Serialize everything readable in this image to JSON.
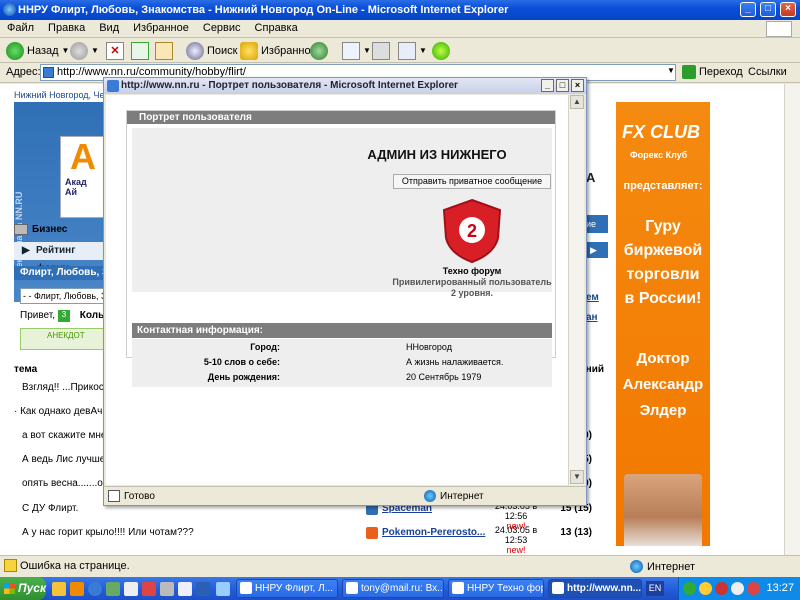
{
  "window": {
    "title": "ННРУ Флирт, Любовь, Знакомства - Нижний Новгород On-Line - Microsoft Internet Explorer",
    "caption_min": "_",
    "caption_max": "□",
    "caption_close": "×"
  },
  "menu": [
    "Файл",
    "Правка",
    "Вид",
    "Избранное",
    "Сервис",
    "Справка"
  ],
  "toolbar": {
    "back_label": "Назад",
    "search_label": "Поиск",
    "favorites_label": "Избранное"
  },
  "address": {
    "label": "Адрес:",
    "value": "http://www.nn.ru/community/hobby/flirt/",
    "go_label": "Переход",
    "links_label": "Ссылки"
  },
  "page": {
    "site_link": "Нижний Новгород, Чет",
    "banner_side": "реклама на NN.RU",
    "banner_brand": "Акад",
    "banner_brand2": "Ай",
    "tab_business": "Бизнес",
    "rating_label": "Рейтинг форум",
    "section_bar": "Флирт, Любовь, З",
    "section_select": "- - Флирт, Любовь, З",
    "greeting": "Привет,",
    "greeting_link": "Кольц",
    "anekdot_label": "АНЕКДОТ",
    "right_big": "А",
    "right_tab": "ие",
    "right_tab2": "",
    "right_links": [
      "ем",
      "ан"
    ],
    "topics_header": "тема",
    "topics_header_right": "ний",
    "topics": [
      {
        "title": "Взгляд!! ...Прикос",
        "author": "",
        "date": "",
        "new": "",
        "count": ""
      },
      {
        "title": "· Как однако девАч",
        "author": "",
        "date": "",
        "new": "",
        "count": ""
      },
      {
        "title": "а вот скажите мне",
        "author": "",
        "date": "",
        "new": "",
        "count": "0)"
      },
      {
        "title": "А ведь Лис лучше в",
        "author": "",
        "date": "",
        "new": "",
        "count": "5)"
      },
      {
        "title": "опять весна.......оп",
        "author": "",
        "date": "",
        "new": "",
        "count": "0)"
      },
      {
        "title": "С ДУ Флирт.",
        "author": "Spaceman",
        "date": "24.03.05 в 12:56",
        "new": "new!",
        "count": "15 (15)"
      },
      {
        "title": "А у нас горит крыло!!!! Или чотам???",
        "author": "Pokemon-Pererosto...",
        "date": "24.03.05 в 12:53",
        "new": "new!",
        "count": "13 (13)"
      }
    ]
  },
  "fx_banner": {
    "logo": "FX CLUB",
    "sub": "Форекс Клуб",
    "presents": "представляет:",
    "lines": [
      "Гуру",
      "биржевой",
      "торговли",
      "в России!"
    ],
    "doctor": [
      "Доктор",
      "Александр",
      "Элдер"
    ]
  },
  "status": {
    "text": "Ошибка на странице.",
    "zone": "Интернет"
  },
  "popup": {
    "title": "http://www.nn.ru - Портрет пользователя - Microsoft Internet Explorer",
    "section_title": "Портрет пользователя",
    "user_name": "АДМИН ИЗ НИЖНЕГО",
    "pm_button": "Отправить приватное сообщение",
    "rank_number": "2",
    "rank_forum": "Техно форум",
    "rank_desc_1": "Привилегированный пользователь",
    "rank_desc_2": "2 уровня.",
    "contact_title": "Контактная информация:",
    "contacts": [
      {
        "label": "Город:",
        "value": "ННовгород"
      },
      {
        "label": "5-10 слов о себе:",
        "value": "А жизнь налаживается."
      },
      {
        "label": "День рождения:",
        "value": "20 Сентябрь 1979"
      }
    ],
    "status_text": "Готово",
    "status_zone": "Интернет"
  },
  "taskbar": {
    "start": "Пуск",
    "tasks": [
      {
        "label": "ННРУ Флирт, Л...",
        "active": false
      },
      {
        "label": "tony@mail.ru: Вх...",
        "active": false
      },
      {
        "label": "ННРУ Техно фор...",
        "active": false
      },
      {
        "label": "http://www.nn....",
        "active": true
      }
    ],
    "lang": "EN",
    "clock": "13:27"
  },
  "colors": {
    "accent_blue": "#2f6fb5",
    "fx_orange": "#f27800",
    "rank_red": "#d91f26",
    "new_red": "#dd0000"
  }
}
